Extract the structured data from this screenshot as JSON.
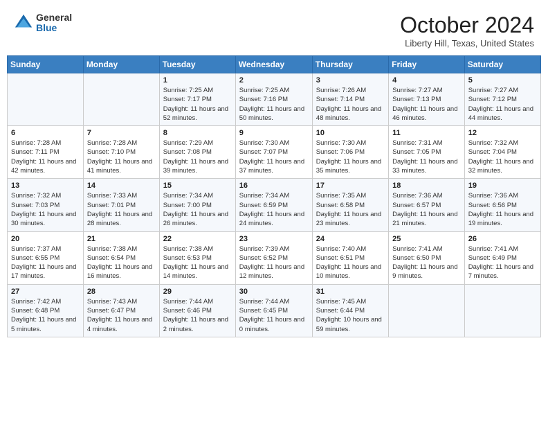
{
  "header": {
    "logo_general": "General",
    "logo_blue": "Blue",
    "month_title": "October 2024",
    "location": "Liberty Hill, Texas, United States"
  },
  "days_of_week": [
    "Sunday",
    "Monday",
    "Tuesday",
    "Wednesday",
    "Thursday",
    "Friday",
    "Saturday"
  ],
  "weeks": [
    [
      {
        "day": "",
        "info": ""
      },
      {
        "day": "",
        "info": ""
      },
      {
        "day": "1",
        "info": "Sunrise: 7:25 AM\nSunset: 7:17 PM\nDaylight: 11 hours and 52 minutes."
      },
      {
        "day": "2",
        "info": "Sunrise: 7:25 AM\nSunset: 7:16 PM\nDaylight: 11 hours and 50 minutes."
      },
      {
        "day": "3",
        "info": "Sunrise: 7:26 AM\nSunset: 7:14 PM\nDaylight: 11 hours and 48 minutes."
      },
      {
        "day": "4",
        "info": "Sunrise: 7:27 AM\nSunset: 7:13 PM\nDaylight: 11 hours and 46 minutes."
      },
      {
        "day": "5",
        "info": "Sunrise: 7:27 AM\nSunset: 7:12 PM\nDaylight: 11 hours and 44 minutes."
      }
    ],
    [
      {
        "day": "6",
        "info": "Sunrise: 7:28 AM\nSunset: 7:11 PM\nDaylight: 11 hours and 42 minutes."
      },
      {
        "day": "7",
        "info": "Sunrise: 7:28 AM\nSunset: 7:10 PM\nDaylight: 11 hours and 41 minutes."
      },
      {
        "day": "8",
        "info": "Sunrise: 7:29 AM\nSunset: 7:08 PM\nDaylight: 11 hours and 39 minutes."
      },
      {
        "day": "9",
        "info": "Sunrise: 7:30 AM\nSunset: 7:07 PM\nDaylight: 11 hours and 37 minutes."
      },
      {
        "day": "10",
        "info": "Sunrise: 7:30 AM\nSunset: 7:06 PM\nDaylight: 11 hours and 35 minutes."
      },
      {
        "day": "11",
        "info": "Sunrise: 7:31 AM\nSunset: 7:05 PM\nDaylight: 11 hours and 33 minutes."
      },
      {
        "day": "12",
        "info": "Sunrise: 7:32 AM\nSunset: 7:04 PM\nDaylight: 11 hours and 32 minutes."
      }
    ],
    [
      {
        "day": "13",
        "info": "Sunrise: 7:32 AM\nSunset: 7:03 PM\nDaylight: 11 hours and 30 minutes."
      },
      {
        "day": "14",
        "info": "Sunrise: 7:33 AM\nSunset: 7:01 PM\nDaylight: 11 hours and 28 minutes."
      },
      {
        "day": "15",
        "info": "Sunrise: 7:34 AM\nSunset: 7:00 PM\nDaylight: 11 hours and 26 minutes."
      },
      {
        "day": "16",
        "info": "Sunrise: 7:34 AM\nSunset: 6:59 PM\nDaylight: 11 hours and 24 minutes."
      },
      {
        "day": "17",
        "info": "Sunrise: 7:35 AM\nSunset: 6:58 PM\nDaylight: 11 hours and 23 minutes."
      },
      {
        "day": "18",
        "info": "Sunrise: 7:36 AM\nSunset: 6:57 PM\nDaylight: 11 hours and 21 minutes."
      },
      {
        "day": "19",
        "info": "Sunrise: 7:36 AM\nSunset: 6:56 PM\nDaylight: 11 hours and 19 minutes."
      }
    ],
    [
      {
        "day": "20",
        "info": "Sunrise: 7:37 AM\nSunset: 6:55 PM\nDaylight: 11 hours and 17 minutes."
      },
      {
        "day": "21",
        "info": "Sunrise: 7:38 AM\nSunset: 6:54 PM\nDaylight: 11 hours and 16 minutes."
      },
      {
        "day": "22",
        "info": "Sunrise: 7:38 AM\nSunset: 6:53 PM\nDaylight: 11 hours and 14 minutes."
      },
      {
        "day": "23",
        "info": "Sunrise: 7:39 AM\nSunset: 6:52 PM\nDaylight: 11 hours and 12 minutes."
      },
      {
        "day": "24",
        "info": "Sunrise: 7:40 AM\nSunset: 6:51 PM\nDaylight: 11 hours and 10 minutes."
      },
      {
        "day": "25",
        "info": "Sunrise: 7:41 AM\nSunset: 6:50 PM\nDaylight: 11 hours and 9 minutes."
      },
      {
        "day": "26",
        "info": "Sunrise: 7:41 AM\nSunset: 6:49 PM\nDaylight: 11 hours and 7 minutes."
      }
    ],
    [
      {
        "day": "27",
        "info": "Sunrise: 7:42 AM\nSunset: 6:48 PM\nDaylight: 11 hours and 5 minutes."
      },
      {
        "day": "28",
        "info": "Sunrise: 7:43 AM\nSunset: 6:47 PM\nDaylight: 11 hours and 4 minutes."
      },
      {
        "day": "29",
        "info": "Sunrise: 7:44 AM\nSunset: 6:46 PM\nDaylight: 11 hours and 2 minutes."
      },
      {
        "day": "30",
        "info": "Sunrise: 7:44 AM\nSunset: 6:45 PM\nDaylight: 11 hours and 0 minutes."
      },
      {
        "day": "31",
        "info": "Sunrise: 7:45 AM\nSunset: 6:44 PM\nDaylight: 10 hours and 59 minutes."
      },
      {
        "day": "",
        "info": ""
      },
      {
        "day": "",
        "info": ""
      }
    ]
  ]
}
